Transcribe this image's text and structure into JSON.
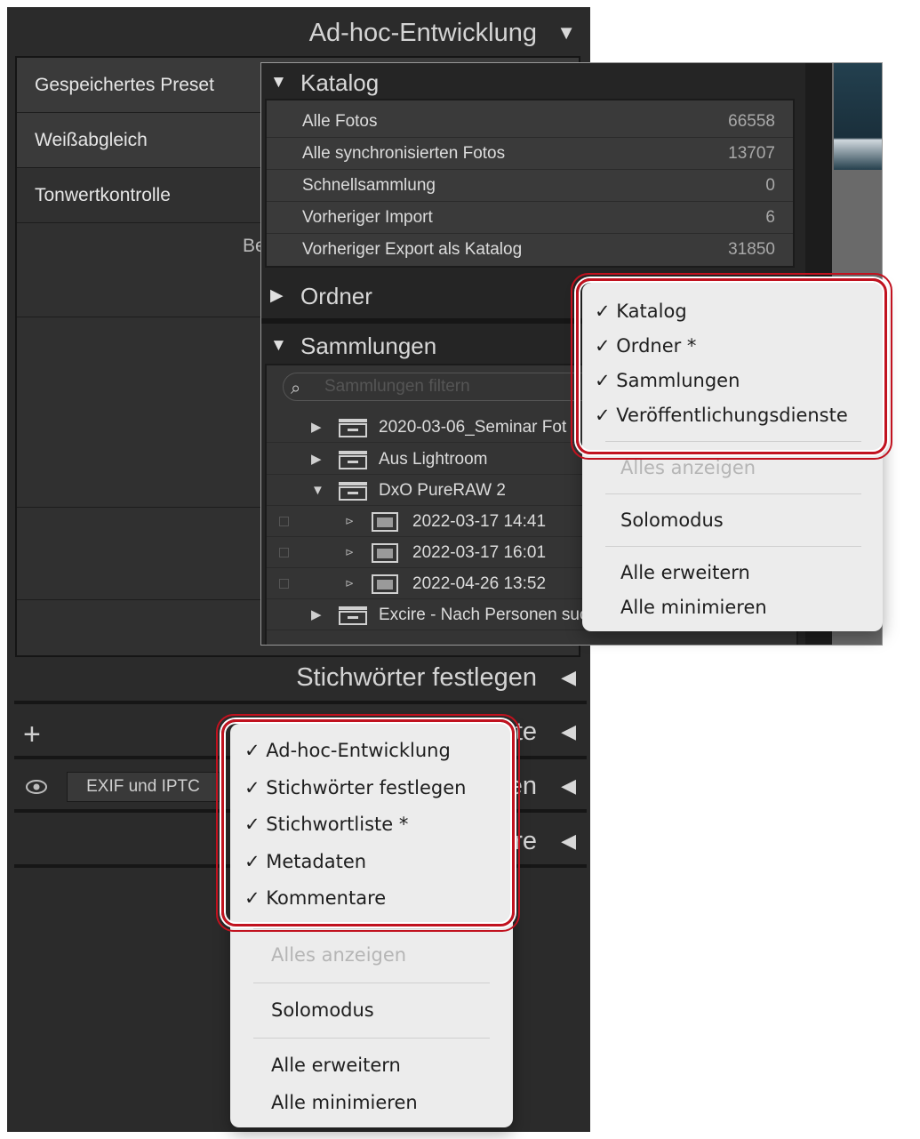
{
  "right_panel": {
    "headers": {
      "adhoc": "Ad-hoc-Entwicklung",
      "keywords": "Stichwörter festlegen",
      "keywordlist": "te",
      "metadata": "en",
      "comments": "re"
    },
    "rows": {
      "preset": "Gespeichertes Preset",
      "whitebalance": "Weißabgleich",
      "tone": "Tonwertkontrolle",
      "partial": "Be"
    },
    "metadata_preset": "EXIF und IPTC"
  },
  "left_panel": {
    "catalog": {
      "title": "Katalog",
      "rows": [
        {
          "label": "Alle Fotos",
          "count": "66558"
        },
        {
          "label": "Alle synchronisierten Fotos",
          "count": "13707"
        },
        {
          "label": "Schnellsammlung",
          "count": "0"
        },
        {
          "label": "Vorheriger Import",
          "count": "6"
        },
        {
          "label": "Vorheriger Export als Katalog",
          "count": "31850"
        }
      ]
    },
    "folders": {
      "title": "Ordner"
    },
    "collections": {
      "title": "Sammlungen",
      "search_placeholder": "Sammlungen filtern",
      "rows": [
        {
          "label": "2020-03-06_Seminar Fot"
        },
        {
          "label": "Aus Lightroom"
        },
        {
          "label": "DxO PureRAW 2"
        },
        {
          "label": "2022-03-17 14:41"
        },
        {
          "label": "2022-03-17 16:01"
        },
        {
          "label": "2022-04-26 13:52"
        },
        {
          "label": "Excire - Nach Personen suc"
        }
      ]
    }
  },
  "left_menu": {
    "items": [
      "✓ Katalog",
      "✓ Ordner *",
      "✓ Sammlungen",
      "✓ Veröffentlichungsdienste"
    ],
    "show_all": "Alles anzeigen",
    "solo": "Solomodus",
    "expand_all": "Alle erweitern",
    "collapse_all": "Alle minimieren"
  },
  "right_menu": {
    "items": [
      "✓ Ad-hoc-Entwicklung",
      "✓ Stichwörter festlegen",
      "✓ Stichwortliste *",
      "✓ Metadaten",
      "✓ Kommentare"
    ],
    "show_all": "Alles anzeigen",
    "solo": "Solomodus",
    "expand_all": "Alle erweitern",
    "collapse_all": "Alle minimieren"
  },
  "colors": {
    "panel_bg": "#2b2b2b",
    "menu_bg": "#ececec",
    "highlight_outline": "#c1121f"
  }
}
